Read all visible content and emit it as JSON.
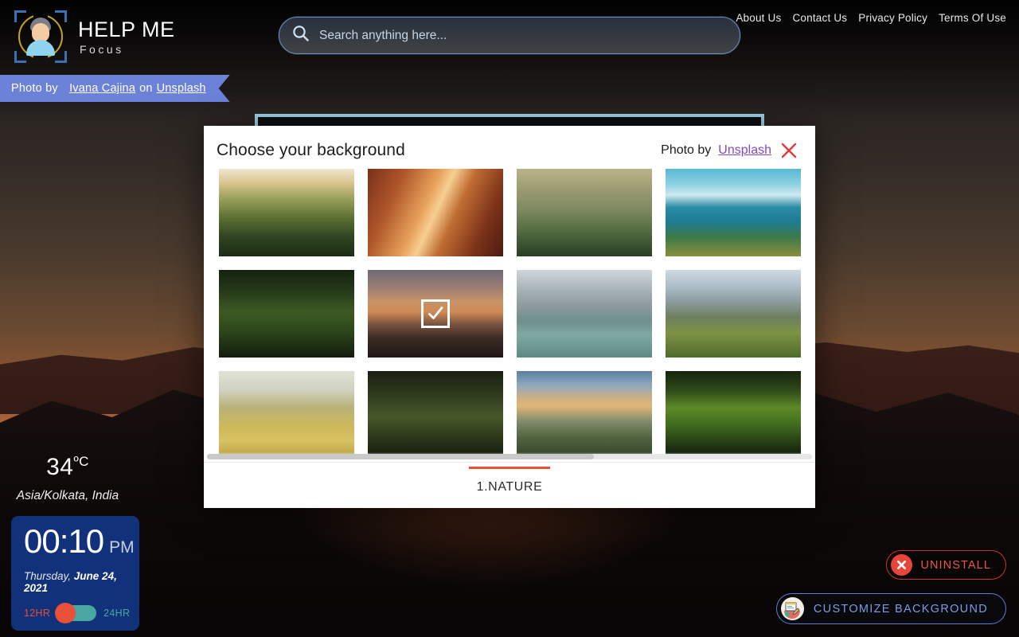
{
  "header": {
    "logo_title": "HELP ME",
    "logo_subtitle": "Focus",
    "nav": [
      {
        "label": "About Us"
      },
      {
        "label": "Contact Us"
      },
      {
        "label": "Privacy Policy"
      },
      {
        "label": "Terms Of Use"
      }
    ]
  },
  "search": {
    "placeholder": "Search anything here...",
    "value": ""
  },
  "photo_credit": {
    "prefix": "Photo by",
    "author": "Ivana Cajina",
    "middle": "on",
    "source": "Unsplash"
  },
  "modal": {
    "title": "Choose your background",
    "credit_text": "Photo by",
    "credit_link": "Unsplash",
    "close_icon": "close-icon",
    "tabs": [
      {
        "label": "1.NATURE",
        "active": true
      }
    ],
    "thumbnails": [
      {
        "alt": "Misty forest hillside at golden hour",
        "selected": false
      },
      {
        "alt": "Autumn forest with sunbeams",
        "selected": false
      },
      {
        "alt": "Hiker on rock outcrop in hazy mountains",
        "selected": false
      },
      {
        "alt": "Turquoise lake island with forested shores",
        "selected": false
      },
      {
        "alt": "Wooden boardwalk through green forest",
        "selected": false
      },
      {
        "alt": "Sunset over mountain ridges",
        "selected": true
      },
      {
        "alt": "Lago di Braies boats and alpine peaks",
        "selected": false
      },
      {
        "alt": "Yosemite El Capitan meadow with pines",
        "selected": false
      },
      {
        "alt": "Lone tree in golden rapeseed field",
        "selected": false
      },
      {
        "alt": "Tall dark pine forest trunks",
        "selected": false
      },
      {
        "alt": "Misty green valley at sunrise",
        "selected": false
      },
      {
        "alt": "Sunlit dense green jungle canopy",
        "selected": false
      }
    ]
  },
  "weather": {
    "temperature": "34",
    "unit": "ºC",
    "location": "Asia/Kolkata, India"
  },
  "clock": {
    "time": "00:10",
    "ampm": "PM",
    "weekday": "Thursday,",
    "date": "June 24, 2021",
    "toggle_left": "12HR",
    "toggle_right": "24HR",
    "toggle_state": "12HR"
  },
  "actions": {
    "uninstall_label": "UNINSTALL",
    "customize_label": "CUSTOMIZE BACKGROUND"
  },
  "colors": {
    "ribbon_blue": "#6b82d8",
    "accent_red": "#e8503a",
    "clock_blue": "#11317a",
    "link_purple": "#8547c4",
    "customize_blue": "#7f9ce2",
    "teal": "#4aa6a0"
  }
}
